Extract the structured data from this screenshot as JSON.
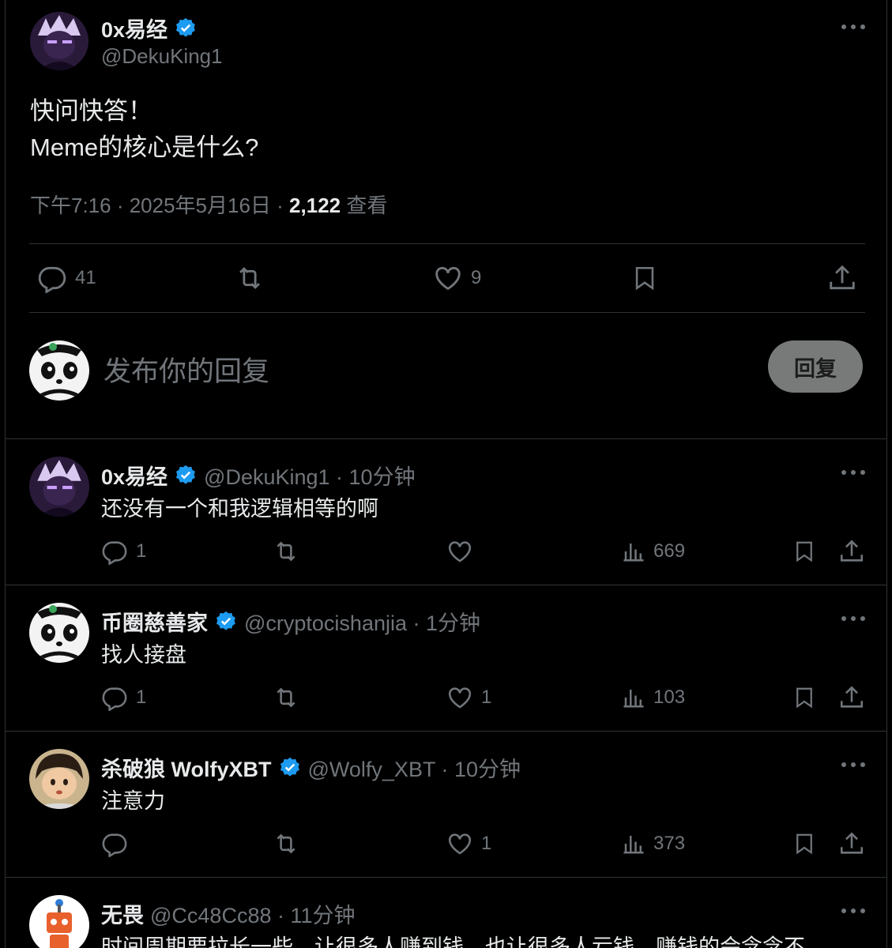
{
  "main_tweet": {
    "display_name": "0x易经",
    "handle": "@DekuKing1",
    "text_line1": "快问快答！",
    "text_line2": "Meme的核心是什么?",
    "time": "下午7:16 · 2025年5月16日 · ",
    "views_count": "2,122",
    "views_label": " 查看",
    "replies": "41",
    "retweets": "",
    "likes": "9"
  },
  "composer": {
    "placeholder": "发布你的回复",
    "button": "回复"
  },
  "replies": [
    {
      "display_name": "0x易经",
      "handle": "@DekuKing1 · 10分钟",
      "text": "还没有一个和我逻辑相等的啊",
      "replies": "1",
      "retweets": "",
      "likes": "",
      "views": "669"
    },
    {
      "display_name": "币圈慈善家",
      "handle": "@cryptocishanjia · 1分钟",
      "text": "找人接盘",
      "replies": "1",
      "retweets": "",
      "likes": "1",
      "views": "103"
    },
    {
      "display_name": "杀破狼 WolfyXBT",
      "handle": "@Wolfy_XBT · 10分钟",
      "text": "注意力",
      "replies": "",
      "retweets": "",
      "likes": "1",
      "views": "373"
    },
    {
      "display_name": "无畏",
      "handle": "@Cc48Cc88 · 11分钟",
      "text": "时间周期要拉长一些，让很多人赚到钱，也让很多人亏钱，赚钱的会念念不"
    }
  ],
  "colors": {
    "background": "#000000",
    "text": "#e7e9ea",
    "muted": "#71767b",
    "verified": "#1d9bf0",
    "border": "#2f3336"
  }
}
